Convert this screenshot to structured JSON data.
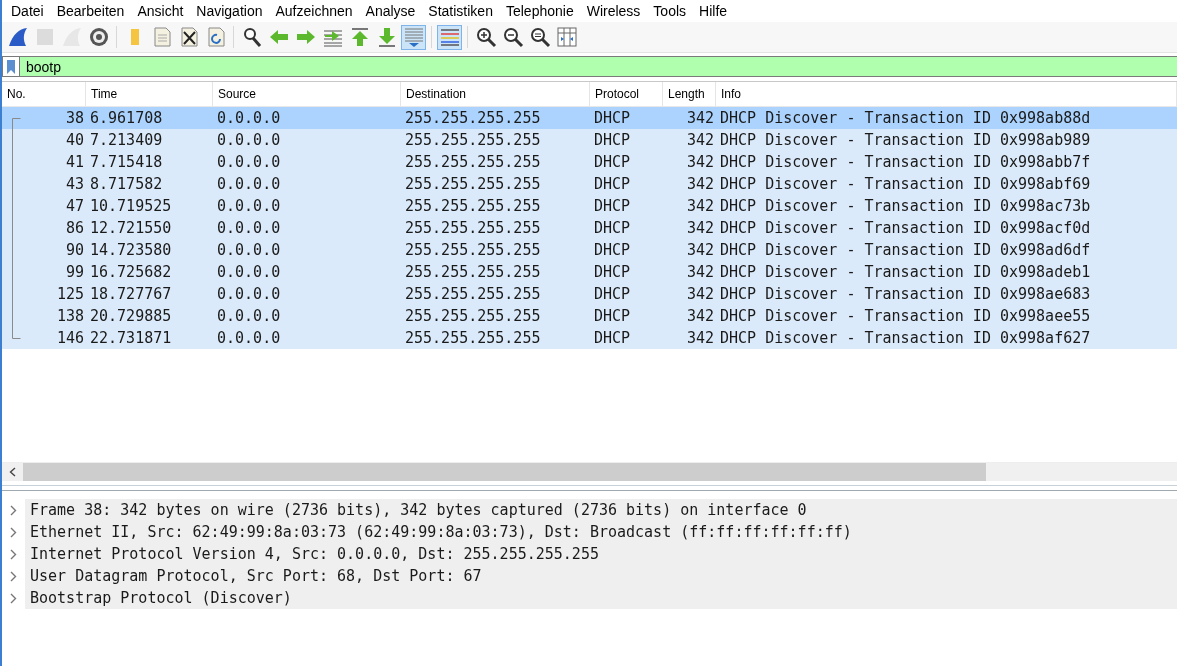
{
  "menu": [
    "Datei",
    "Bearbeiten",
    "Ansicht",
    "Navigation",
    "Aufzeichnen",
    "Analyse",
    "Statistiken",
    "Telephonie",
    "Wireless",
    "Tools",
    "Hilfe"
  ],
  "toolbar": [
    {
      "kind": "start",
      "disabled": false,
      "pressed": false
    },
    {
      "kind": "stop",
      "disabled": true,
      "pressed": false
    },
    {
      "kind": "restart",
      "disabled": true,
      "pressed": false
    },
    {
      "kind": "options",
      "disabled": false,
      "pressed": false,
      "group_end": true
    },
    {
      "kind": "open",
      "disabled": false,
      "pressed": false
    },
    {
      "kind": "save",
      "disabled": false,
      "pressed": false
    },
    {
      "kind": "close",
      "disabled": false,
      "pressed": false
    },
    {
      "kind": "reload",
      "disabled": false,
      "pressed": false,
      "group_end": true
    },
    {
      "kind": "find",
      "disabled": false,
      "pressed": false
    },
    {
      "kind": "back",
      "disabled": false,
      "pressed": false
    },
    {
      "kind": "forward",
      "disabled": false,
      "pressed": false
    },
    {
      "kind": "goto",
      "disabled": false,
      "pressed": false
    },
    {
      "kind": "first",
      "disabled": false,
      "pressed": false
    },
    {
      "kind": "last",
      "disabled": false,
      "pressed": false
    },
    {
      "kind": "autoscroll",
      "disabled": false,
      "pressed": true,
      "group_end": true
    },
    {
      "kind": "colorize",
      "disabled": false,
      "pressed": true,
      "group_end": true
    },
    {
      "kind": "zoomin",
      "disabled": false,
      "pressed": false
    },
    {
      "kind": "zoomout",
      "disabled": false,
      "pressed": false
    },
    {
      "kind": "zoomreset",
      "disabled": false,
      "pressed": false
    },
    {
      "kind": "resize",
      "disabled": false,
      "pressed": false
    }
  ],
  "filter": {
    "value": "bootp"
  },
  "table": {
    "columns": [
      "No.",
      "Time",
      "Source",
      "Destination",
      "Protocol",
      "Length",
      "Info"
    ],
    "rows": [
      {
        "selected": true,
        "cells": [
          "38",
          "6.961708",
          "0.0.0.0",
          "255.255.255.255",
          "DHCP",
          "342",
          "DHCP Discover - Transaction ID 0x998ab88d"
        ]
      },
      {
        "selected": false,
        "cells": [
          "40",
          "7.213409",
          "0.0.0.0",
          "255.255.255.255",
          "DHCP",
          "342",
          "DHCP Discover - Transaction ID 0x998ab989"
        ]
      },
      {
        "selected": false,
        "cells": [
          "41",
          "7.715418",
          "0.0.0.0",
          "255.255.255.255",
          "DHCP",
          "342",
          "DHCP Discover - Transaction ID 0x998abb7f"
        ]
      },
      {
        "selected": false,
        "cells": [
          "43",
          "8.717582",
          "0.0.0.0",
          "255.255.255.255",
          "DHCP",
          "342",
          "DHCP Discover - Transaction ID 0x998abf69"
        ]
      },
      {
        "selected": false,
        "cells": [
          "47",
          "10.719525",
          "0.0.0.0",
          "255.255.255.255",
          "DHCP",
          "342",
          "DHCP Discover - Transaction ID 0x998ac73b"
        ]
      },
      {
        "selected": false,
        "cells": [
          "86",
          "12.721550",
          "0.0.0.0",
          "255.255.255.255",
          "DHCP",
          "342",
          "DHCP Discover - Transaction ID 0x998acf0d"
        ]
      },
      {
        "selected": false,
        "cells": [
          "90",
          "14.723580",
          "0.0.0.0",
          "255.255.255.255",
          "DHCP",
          "342",
          "DHCP Discover - Transaction ID 0x998ad6df"
        ]
      },
      {
        "selected": false,
        "cells": [
          "99",
          "16.725682",
          "0.0.0.0",
          "255.255.255.255",
          "DHCP",
          "342",
          "DHCP Discover - Transaction ID 0x998adeb1"
        ]
      },
      {
        "selected": false,
        "cells": [
          "125",
          "18.727767",
          "0.0.0.0",
          "255.255.255.255",
          "DHCP",
          "342",
          "DHCP Discover - Transaction ID 0x998ae683"
        ]
      },
      {
        "selected": false,
        "cells": [
          "138",
          "20.729885",
          "0.0.0.0",
          "255.255.255.255",
          "DHCP",
          "342",
          "DHCP Discover - Transaction ID 0x998aee55"
        ]
      },
      {
        "selected": false,
        "cells": [
          "146",
          "22.731871",
          "0.0.0.0",
          "255.255.255.255",
          "DHCP",
          "342",
          "DHCP Discover - Transaction ID 0x998af627"
        ]
      }
    ]
  },
  "details": [
    {
      "text": "Frame 38: 342 bytes on wire (2736 bits), 342 bytes captured (2736 bits) on interface 0",
      "expanded": false
    },
    {
      "text": "Ethernet II, Src: 62:49:99:8a:03:73 (62:49:99:8a:03:73), Dst: Broadcast (ff:ff:ff:ff:ff:ff)",
      "expanded": false
    },
    {
      "text": "Internet Protocol Version 4, Src: 0.0.0.0, Dst: 255.255.255.255",
      "expanded": false
    },
    {
      "text": "User Datagram Protocol, Src Port: 68, Dst Port: 67",
      "expanded": false
    },
    {
      "text": "Bootstrap Protocol (Discover)",
      "expanded": false
    }
  ]
}
